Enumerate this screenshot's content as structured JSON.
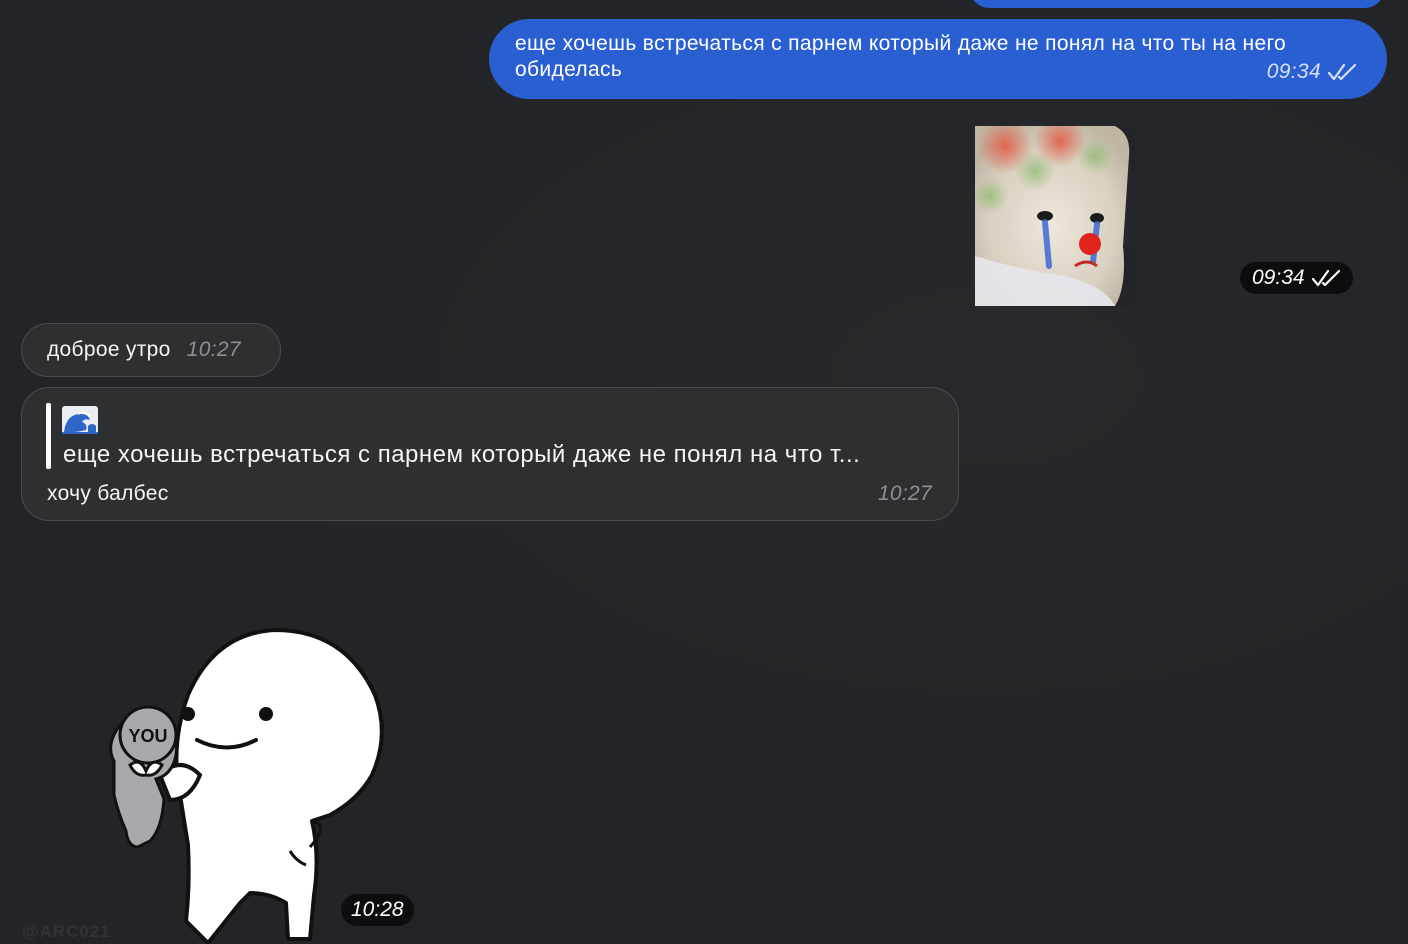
{
  "messages": {
    "outgoing_text": {
      "text": "еще хочешь встречаться с парнем который даже не понял на что ты на него обиделась",
      "time": "09:34",
      "status_icon": "double-check-icon"
    },
    "outgoing_sticker": {
      "time": "09:34",
      "status_icon": "double-check-icon",
      "sticker": "crying-clown-cat"
    },
    "incoming_greeting": {
      "text": "доброе утро",
      "time": "10:27"
    },
    "incoming_reply": {
      "quoted_emoji": "wave-icon",
      "quoted_text": "еще хочешь встречаться с парнем который даже не понял на что т...",
      "text": "хочу балбес",
      "time": "10:27"
    },
    "incoming_sticker": {
      "time": "10:28",
      "sticker": "white-blob-holding-you-doll",
      "doll_label": "YOU",
      "watermark": "@ARC021"
    }
  },
  "colors": {
    "background": "#222427",
    "outgoing_bubble": "#2a5fd1",
    "incoming_bubble": "#2e2f31",
    "time_pill": "#0a0a0c"
  }
}
